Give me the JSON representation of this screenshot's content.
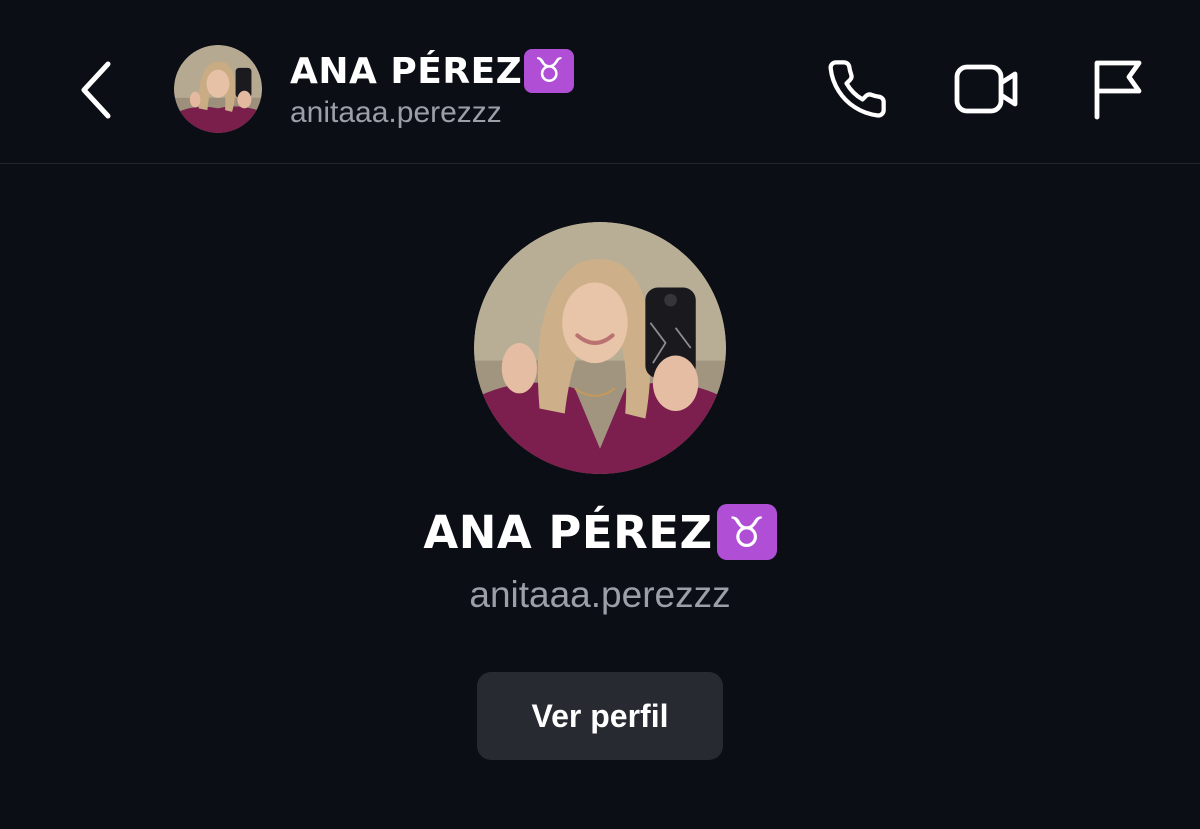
{
  "header": {
    "back_icon": "chevron-left-icon",
    "name": "ANA PÉREZ",
    "zodiac_emoji": "♉",
    "username": "anitaaa.perezzz",
    "actions": {
      "call_icon": "phone-icon",
      "video_icon": "video-camera-icon",
      "report_icon": "flag-icon"
    }
  },
  "profile": {
    "name": "ANA PÉREZ",
    "zodiac_emoji": "♉",
    "username": "anitaaa.perezzz",
    "view_profile_label": "Ver perfil"
  },
  "colors": {
    "background": "#0b0e14",
    "text_primary": "#ffffff",
    "text_secondary": "#9a9fa8",
    "divider": "#23262d",
    "button_bg": "#272a31",
    "zodiac_badge": "#b04fd6"
  }
}
